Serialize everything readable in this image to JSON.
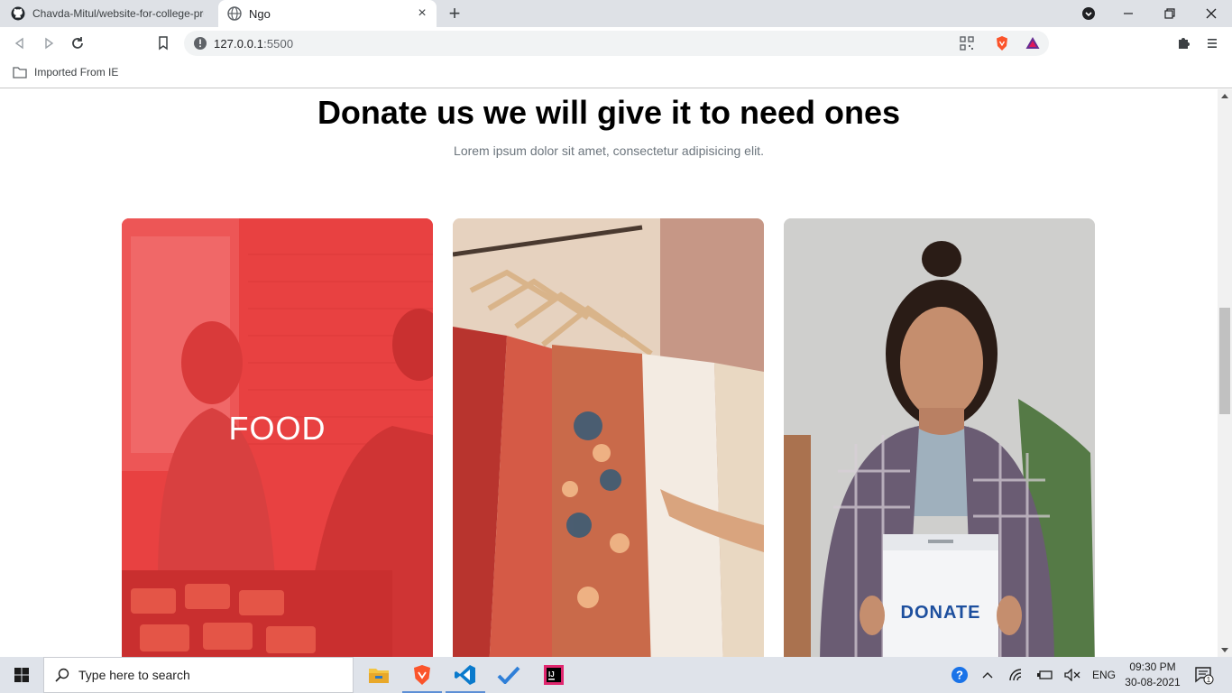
{
  "browser": {
    "tabs": [
      {
        "title": "Chavda-Mitul/website-for-college-pro",
        "active": false
      },
      {
        "title": "Ngo",
        "active": true
      }
    ],
    "url": {
      "host": "127.0.0.1",
      "port": ":5500"
    },
    "bookmarks": [
      {
        "label": "Imported From IE"
      }
    ]
  },
  "page": {
    "heading": "Donate us we will give it to need ones",
    "subheading": "Lorem ipsum dolor sit amet, consectetur adipisicing elit.",
    "cards": [
      {
        "label": "FOOD",
        "overlay_color": "#e53935"
      },
      {
        "label": "",
        "image": "clothes-on-hangers"
      },
      {
        "label": "",
        "image": "woman-with-donation-box",
        "box_text": "DONATE"
      }
    ]
  },
  "taskbar": {
    "search_placeholder": "Type here to search",
    "language": "ENG",
    "time": "09:30 PM",
    "date": "30-08-2021",
    "notification_count": "1"
  }
}
